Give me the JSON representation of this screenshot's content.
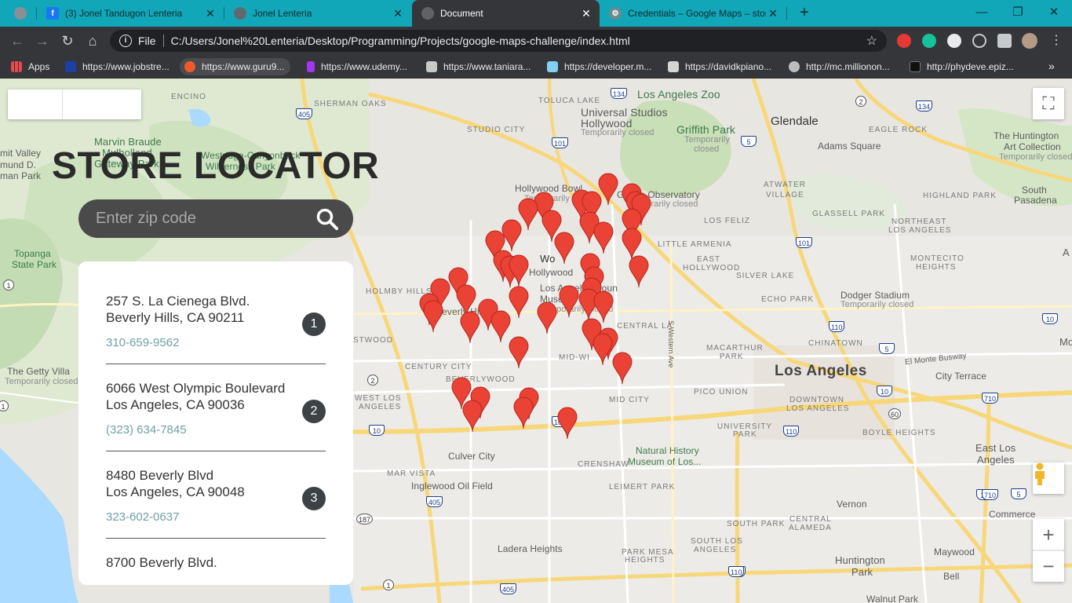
{
  "browser": {
    "tabs": [
      {
        "title": "",
        "favicon": "chrome-icon"
      },
      {
        "title": "(3) Jonel Tandugon Lenteria",
        "favicon": "facebook-icon"
      },
      {
        "title": "Jonel Lenteria",
        "favicon": "globe-icon"
      },
      {
        "title": "Document",
        "favicon": "globe-icon",
        "active": true
      },
      {
        "title": "Credentials – Google Maps – stor",
        "favicon": "gear-icon"
      }
    ],
    "new_tab": "+",
    "window": {
      "minimize": "—",
      "restore": "❐",
      "close": "✕"
    },
    "address": {
      "scheme": "File",
      "url": "C:/Users/Jonel%20Lenteria/Desktop/Programming/Projects/google-maps-challenge/index.html"
    },
    "bookmarks": [
      {
        "label": "Apps"
      },
      {
        "label": "https://www.jobstre..."
      },
      {
        "label": "https://www.guru9..."
      },
      {
        "label": "https://www.udemy..."
      },
      {
        "label": "https://www.taniara..."
      },
      {
        "label": "https://developer.m..."
      },
      {
        "label": "https://davidkpiano..."
      },
      {
        "label": "http://mc.millionon..."
      },
      {
        "label": "http://phydeve.epiz..."
      }
    ],
    "bookmarks_more": "»"
  },
  "map": {
    "labels": {
      "encino": "ENCINO",
      "sherman_oaks": "SHERMAN OAKS",
      "toluca_lake": "TOLUCA LAKE",
      "studio_city": "STUDIO CITY",
      "la_zoo": "Los Angeles Zoo",
      "universal": "Universal Studios",
      "universal2": "Hollywood",
      "universal3": "Temporarily closed",
      "griffith_park": "Griffith Park",
      "griffith_park2": "Temporarily",
      "griffith_park3": "closed",
      "glendale": "Glendale",
      "eagle_rock": "EAGLE ROCK",
      "adams_square": "Adams Square",
      "huntington": "The Huntington",
      "huntington2": "Art Collection",
      "huntington3": "Temporarily closed",
      "pasadena_edge": "Pa",
      "marvin": "Marvin Braude",
      "marvin2": "Mulholland",
      "marvin3": "Gateway Park",
      "westridge": "Westridge-Canyonback",
      "westridge2": "Wilderness Park",
      "hollywood_bowl": "Hollywood Bowl",
      "hollywood_bowl2": "Temporarily closed",
      "griffith_obs": "Griffith Observatory",
      "griffith_obs2": "Temporarily closed",
      "atwater": "ATWATER",
      "atwater2": "VILLAGE",
      "highland_park": "HIGHLAND PARK",
      "south_pasadena": "South",
      "south_pasadena2": "Pasadena",
      "mit_valley": "mit Valley",
      "mund_d": "mund D.",
      "man_park": "man Park",
      "los_feliz": "LOS FELIZ",
      "glassell": "GLASSELL PARK",
      "ne_la": "NORTHEAST",
      "ne_la2": "LOS ANGELES",
      "topanga": "Topanga",
      "topanga2": "State Park",
      "west_hollywood": "Wo",
      "hollywood": "Hollywood",
      "little_armenia": "LITTLE ARMENIA",
      "east_hollywood": "EAST",
      "east_hollywood2": "HOLLYWOOD",
      "montecito": "MONTECITO",
      "montecito2": "HEIGHTS",
      "silver_lake": "SILVER LAKE",
      "holmby_hills": "HOLMBY HILLS",
      "beverly_hills": "Beverly Hills",
      "lacma": "Los Angeles Coun",
      "lacma2": "Museum of Art",
      "lacma3": "Temporarily closed",
      "echo_park": "ECHO PARK",
      "dodger": "Dodger Stadium",
      "dodger2": "Temporarily closed",
      "westwood": "STWOOD",
      "central_la": "CENTRAL LA",
      "chinatown": "CHINATOWN",
      "western_ave": "S Western Ave",
      "getty": "The Getty Villa",
      "getty2": "Temporarily closed",
      "century_city": "CENTURY CITY",
      "beverlywood": "BEVERLYWOOD",
      "mid_wilshire": "MID-WI",
      "macarthur": "MACARTHUR",
      "macarthur2": "PARK",
      "los_angeles": "Los Angeles",
      "el_monte": "El Monte Busway",
      "city_terrace": "City Terrace",
      "west_la": "WEST LOS",
      "west_la2": "ANGELES",
      "mid_city": "MID CITY",
      "pico_union": "PICO UNION",
      "downtown": "DOWNTOWN",
      "downtown2": "LOS ANGELES",
      "university_park": "UNIVERSITY",
      "university_park2": "PARK",
      "boyle": "BOYLE HEIGHTS",
      "east_la": "East Los",
      "east_la2": "Angeles",
      "culver_city": "Culver City",
      "mar_vista": "MAR VISTA",
      "crenshaw": "CRENSHAW",
      "natural_history": "Natural History",
      "natural_history2": "Museum of Los...",
      "inglewood_oil": "Inglewood Oil Field",
      "leimert": "LEIMERT PARK",
      "vernon": "Vernon",
      "commerce": "Commerce",
      "south_park": "SOUTH PARK",
      "central_alameda": "CENTRAL",
      "central_alameda2": "ALAMEDA",
      "ladera": "Ladera Heights",
      "park_mesa": "PARK MESA",
      "park_mesa2": "HEIGHTS",
      "south_la": "SOUTH LOS",
      "south_la2": "ANGELES",
      "huntington_park": "Huntington",
      "huntington_park2": "Park",
      "maywood": "Maywood",
      "bell": "Bell",
      "walnut_park": "Walnut Park",
      "mo_edge": "Mo",
      "a_edge": "A"
    },
    "road_shields": [
      "405",
      "101",
      "134",
      "2",
      "134",
      "5",
      "101",
      "110",
      "10",
      "5",
      "10",
      "110",
      "110",
      "60",
      "710",
      "10",
      "710",
      "5",
      "405",
      "187",
      "110",
      "105",
      "405",
      "2",
      "10",
      "1",
      "1",
      "1"
    ],
    "controls": {
      "fullscreen": "⛶",
      "zoom_in": "+",
      "zoom_out": "−"
    }
  },
  "locator": {
    "title": "STORE LOCATOR",
    "search_placeholder": "Enter zip code",
    "stores": [
      {
        "address1": "257 S. La Cienega Blvd.",
        "address2": "Beverly Hills, CA 90211",
        "phone": "310-659-9562",
        "number": "1"
      },
      {
        "address1": "6066 West Olympic Boulevard",
        "address2": "Los Angeles, CA 90036",
        "phone": "(323) 634-7845",
        "number": "2"
      },
      {
        "address1": "8480 Beverly Blvd",
        "address2": "Los Angeles, CA 90048",
        "phone": "323-602-0637",
        "number": "3"
      },
      {
        "address1": "8700 Beverly Blvd.",
        "address2": "",
        "phone": "",
        "number": ""
      }
    ]
  },
  "colors": {
    "tab_bar": "#11a7b9",
    "toolbar": "#35363a",
    "pin": "#ea4335",
    "search_bg": "#4a4a4a",
    "number_badge": "#3d4246",
    "phone": "#6e9fa3"
  }
}
